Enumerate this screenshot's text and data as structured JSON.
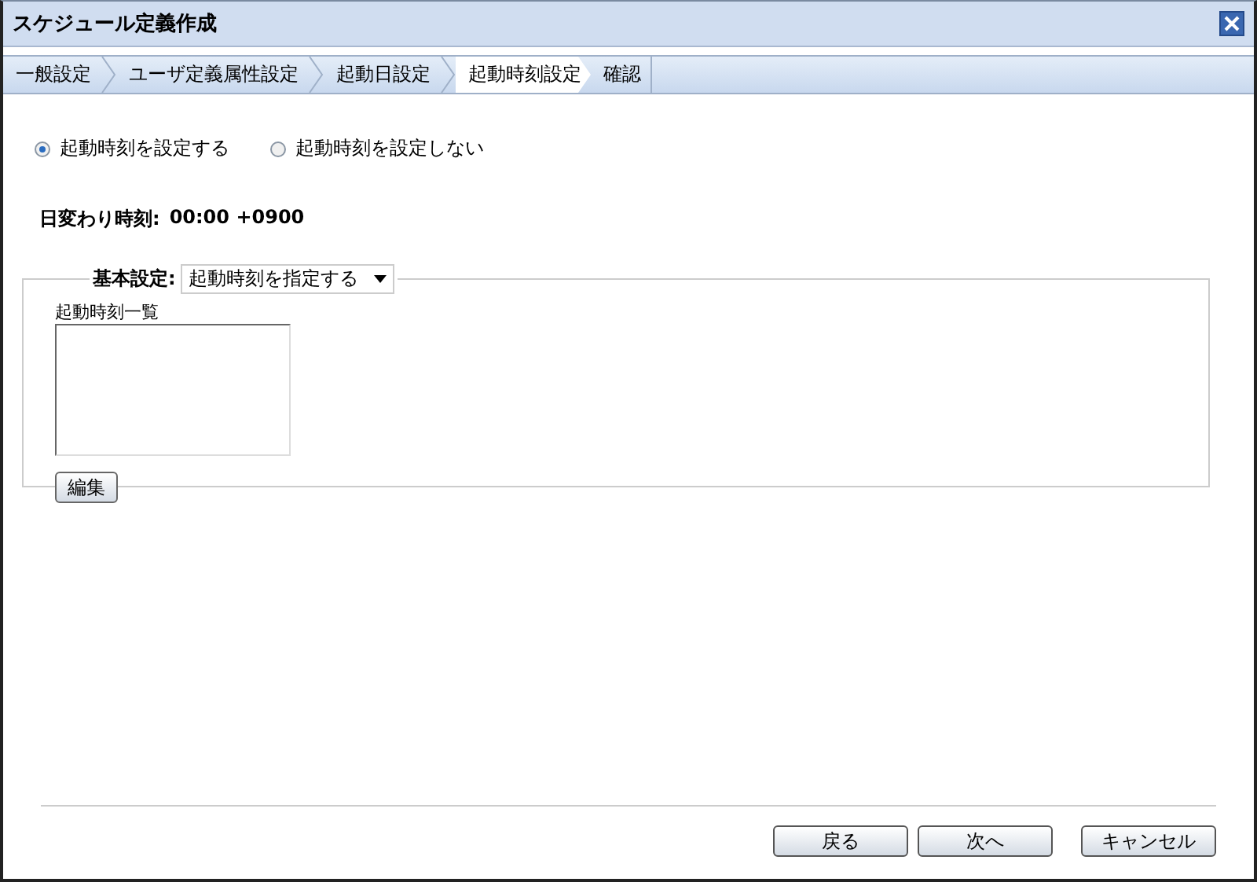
{
  "window": {
    "title": "スケジュール定義作成"
  },
  "steps": [
    {
      "label": "一般設定",
      "selected": false
    },
    {
      "label": "ユーザ定義属性設定",
      "selected": false
    },
    {
      "label": "起動日設定",
      "selected": false
    },
    {
      "label": "起動時刻設定",
      "selected": true
    },
    {
      "label": "確認",
      "selected": false
    }
  ],
  "radios": [
    {
      "label": "起動時刻を設定する",
      "selected": true
    },
    {
      "label": "起動時刻を設定しない",
      "selected": false
    }
  ],
  "day_change": {
    "label": "日変わり時刻:",
    "value": "00:00 +0900"
  },
  "basic": {
    "label": "基本設定:",
    "select_value": "起動時刻を指定する",
    "list_label": "起動時刻一覧",
    "edit_button": "編集"
  },
  "buttons": [
    "戻る",
    "次へ",
    "キャンセル"
  ]
}
